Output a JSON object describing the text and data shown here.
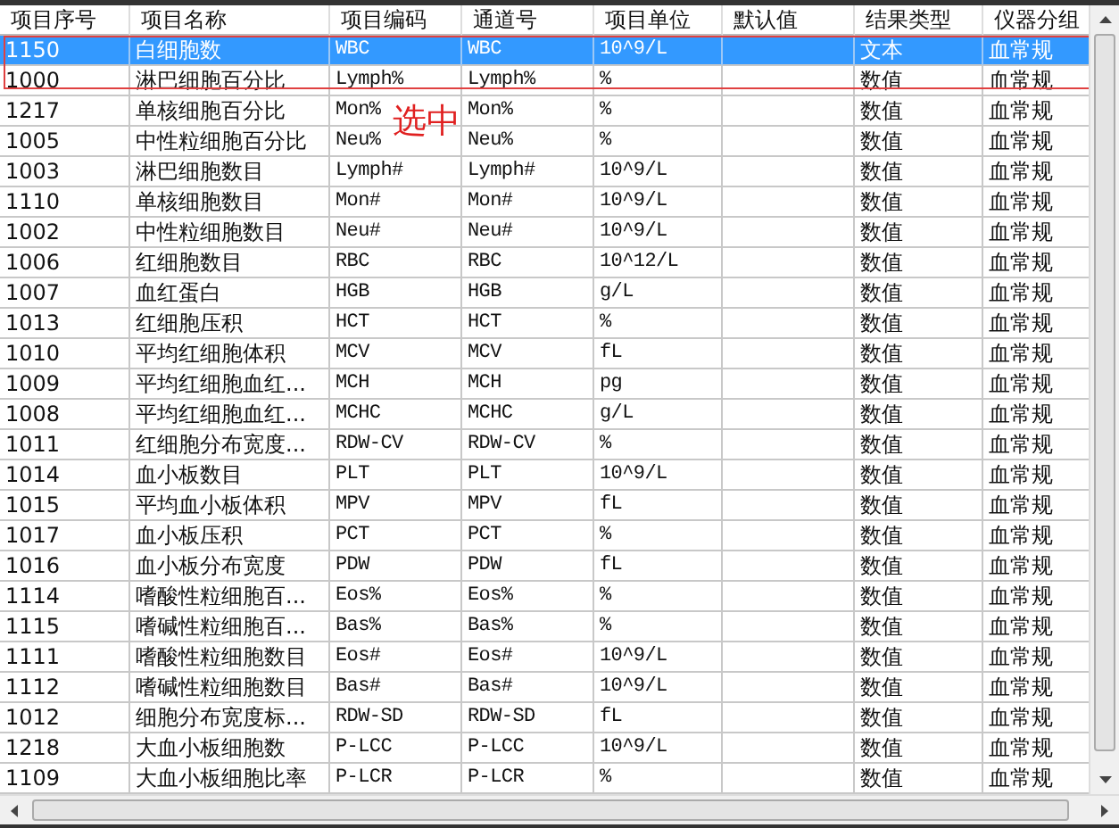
{
  "table": {
    "columns": [
      "项目序号",
      "项目名称",
      "项目编码",
      "通道号",
      "项目单位",
      "默认值",
      "结果类型",
      "仪器分组"
    ],
    "rows": [
      {
        "cells": [
          "1150",
          "白细胞数",
          "WBC",
          "WBC",
          "10^9/L",
          "",
          "文本",
          "血常规"
        ],
        "selected": true
      },
      {
        "cells": [
          "1000",
          "淋巴细胞百分比",
          "Lymph%",
          "Lymph%",
          "%",
          "",
          "数值",
          "血常规"
        ],
        "selected": false
      },
      {
        "cells": [
          "1217",
          "单核细胞百分比",
          "Mon%",
          "Mon%",
          "%",
          "",
          "数值",
          "血常规"
        ],
        "selected": false
      },
      {
        "cells": [
          "1005",
          "中性粒细胞百分比",
          "Neu%",
          "Neu%",
          "%",
          "",
          "数值",
          "血常规"
        ],
        "selected": false
      },
      {
        "cells": [
          "1003",
          "淋巴细胞数目",
          "Lymph#",
          "Lymph#",
          "10^9/L",
          "",
          "数值",
          "血常规"
        ],
        "selected": false
      },
      {
        "cells": [
          "1110",
          "单核细胞数目",
          "Mon#",
          "Mon#",
          "10^9/L",
          "",
          "数值",
          "血常规"
        ],
        "selected": false
      },
      {
        "cells": [
          "1002",
          "中性粒细胞数目",
          "Neu#",
          "Neu#",
          "10^9/L",
          "",
          "数值",
          "血常规"
        ],
        "selected": false
      },
      {
        "cells": [
          "1006",
          "红细胞数目",
          "RBC",
          "RBC",
          "10^12/L",
          "",
          "数值",
          "血常规"
        ],
        "selected": false
      },
      {
        "cells": [
          "1007",
          "血红蛋白",
          "HGB",
          "HGB",
          "g/L",
          "",
          "数值",
          "血常规"
        ],
        "selected": false
      },
      {
        "cells": [
          "1013",
          "红细胞压积",
          "HCT",
          "HCT",
          "%",
          "",
          "数值",
          "血常规"
        ],
        "selected": false
      },
      {
        "cells": [
          "1010",
          "平均红细胞体积",
          "MCV",
          "MCV",
          "fL",
          "",
          "数值",
          "血常规"
        ],
        "selected": false
      },
      {
        "cells": [
          "1009",
          "平均红细胞血红...",
          "MCH",
          "MCH",
          "pg",
          "",
          "数值",
          "血常规"
        ],
        "selected": false
      },
      {
        "cells": [
          "1008",
          "平均红细胞血红...",
          "MCHC",
          "MCHC",
          "g/L",
          "",
          "数值",
          "血常规"
        ],
        "selected": false
      },
      {
        "cells": [
          "1011",
          "红细胞分布宽度...",
          "RDW-CV",
          "RDW-CV",
          "%",
          "",
          "数值",
          "血常规"
        ],
        "selected": false
      },
      {
        "cells": [
          "1014",
          "血小板数目",
          "PLT",
          "PLT",
          "10^9/L",
          "",
          "数值",
          "血常规"
        ],
        "selected": false
      },
      {
        "cells": [
          "1015",
          "平均血小板体积",
          "MPV",
          "MPV",
          "fL",
          "",
          "数值",
          "血常规"
        ],
        "selected": false
      },
      {
        "cells": [
          "1017",
          "血小板压积",
          "PCT",
          "PCT",
          "%",
          "",
          "数值",
          "血常规"
        ],
        "selected": false
      },
      {
        "cells": [
          "1016",
          "血小板分布宽度",
          "PDW",
          "PDW",
          "fL",
          "",
          "数值",
          "血常规"
        ],
        "selected": false
      },
      {
        "cells": [
          "1114",
          "嗜酸性粒细胞百...",
          "Eos%",
          "Eos%",
          "%",
          "",
          "数值",
          "血常规"
        ],
        "selected": false
      },
      {
        "cells": [
          "1115",
          "嗜碱性粒细胞百...",
          "Bas%",
          "Bas%",
          "%",
          "",
          "数值",
          "血常规"
        ],
        "selected": false
      },
      {
        "cells": [
          "1111",
          "嗜酸性粒细胞数目",
          "Eos#",
          "Eos#",
          "10^9/L",
          "",
          "数值",
          "血常规"
        ],
        "selected": false
      },
      {
        "cells": [
          "1112",
          "嗜碱性粒细胞数目",
          "Bas#",
          "Bas#",
          "10^9/L",
          "",
          "数值",
          "血常规"
        ],
        "selected": false
      },
      {
        "cells": [
          "1012",
          "细胞分布宽度标...",
          "RDW-SD",
          "RDW-SD",
          "fL",
          "",
          "数值",
          "血常规"
        ],
        "selected": false
      },
      {
        "cells": [
          "1218",
          "大血小板细胞数",
          "P-LCC",
          "P-LCC",
          "10^9/L",
          "",
          "数值",
          "血常规"
        ],
        "selected": false
      },
      {
        "cells": [
          "1109",
          "大血小板细胞比率",
          "P-LCR",
          "P-LCR",
          "%",
          "",
          "数值",
          "血常规"
        ],
        "selected": false
      }
    ]
  },
  "annotation": {
    "text": "选中"
  }
}
